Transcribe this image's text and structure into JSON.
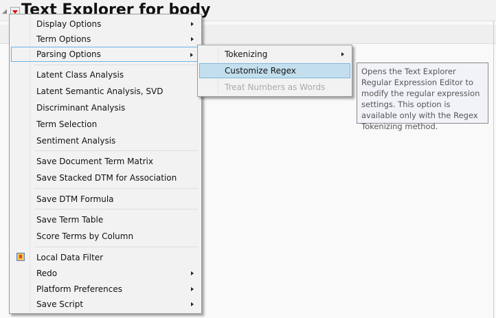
{
  "header": {
    "title": "Text Explorer for body"
  },
  "menu": {
    "items": [
      {
        "label": "Display Options",
        "submenu": true
      },
      {
        "label": "Term Options",
        "submenu": true
      },
      {
        "label": "Parsing Options",
        "submenu": true,
        "selected": true
      },
      {
        "label": "Latent Class Analysis"
      },
      {
        "label": "Latent Semantic Analysis, SVD"
      },
      {
        "label": "Discriminant Analysis"
      },
      {
        "label": "Term Selection"
      },
      {
        "label": "Sentiment Analysis"
      },
      {
        "label": "Save Document Term Matrix"
      },
      {
        "label": "Save Stacked DTM for Association"
      },
      {
        "label": "Save DTM Formula"
      },
      {
        "label": "Save Term Table"
      },
      {
        "label": "Score Terms by Column"
      },
      {
        "label": "Local Data Filter",
        "icon": "filter-icon"
      },
      {
        "label": "Redo",
        "submenu": true
      },
      {
        "label": "Platform Preferences",
        "submenu": true
      },
      {
        "label": "Save Script",
        "submenu": true
      }
    ]
  },
  "submenu": {
    "items": [
      {
        "label": "Tokenizing",
        "submenu": true
      },
      {
        "label": "Customize Regex",
        "highlighted": true
      },
      {
        "label": "Treat Numbers as Words",
        "disabled": true
      }
    ]
  },
  "tooltip": {
    "text": "Opens the Text Explorer Regular Expression Editor to modify the regular expression settings. This option is available only with the Regex Tokenizing method."
  }
}
